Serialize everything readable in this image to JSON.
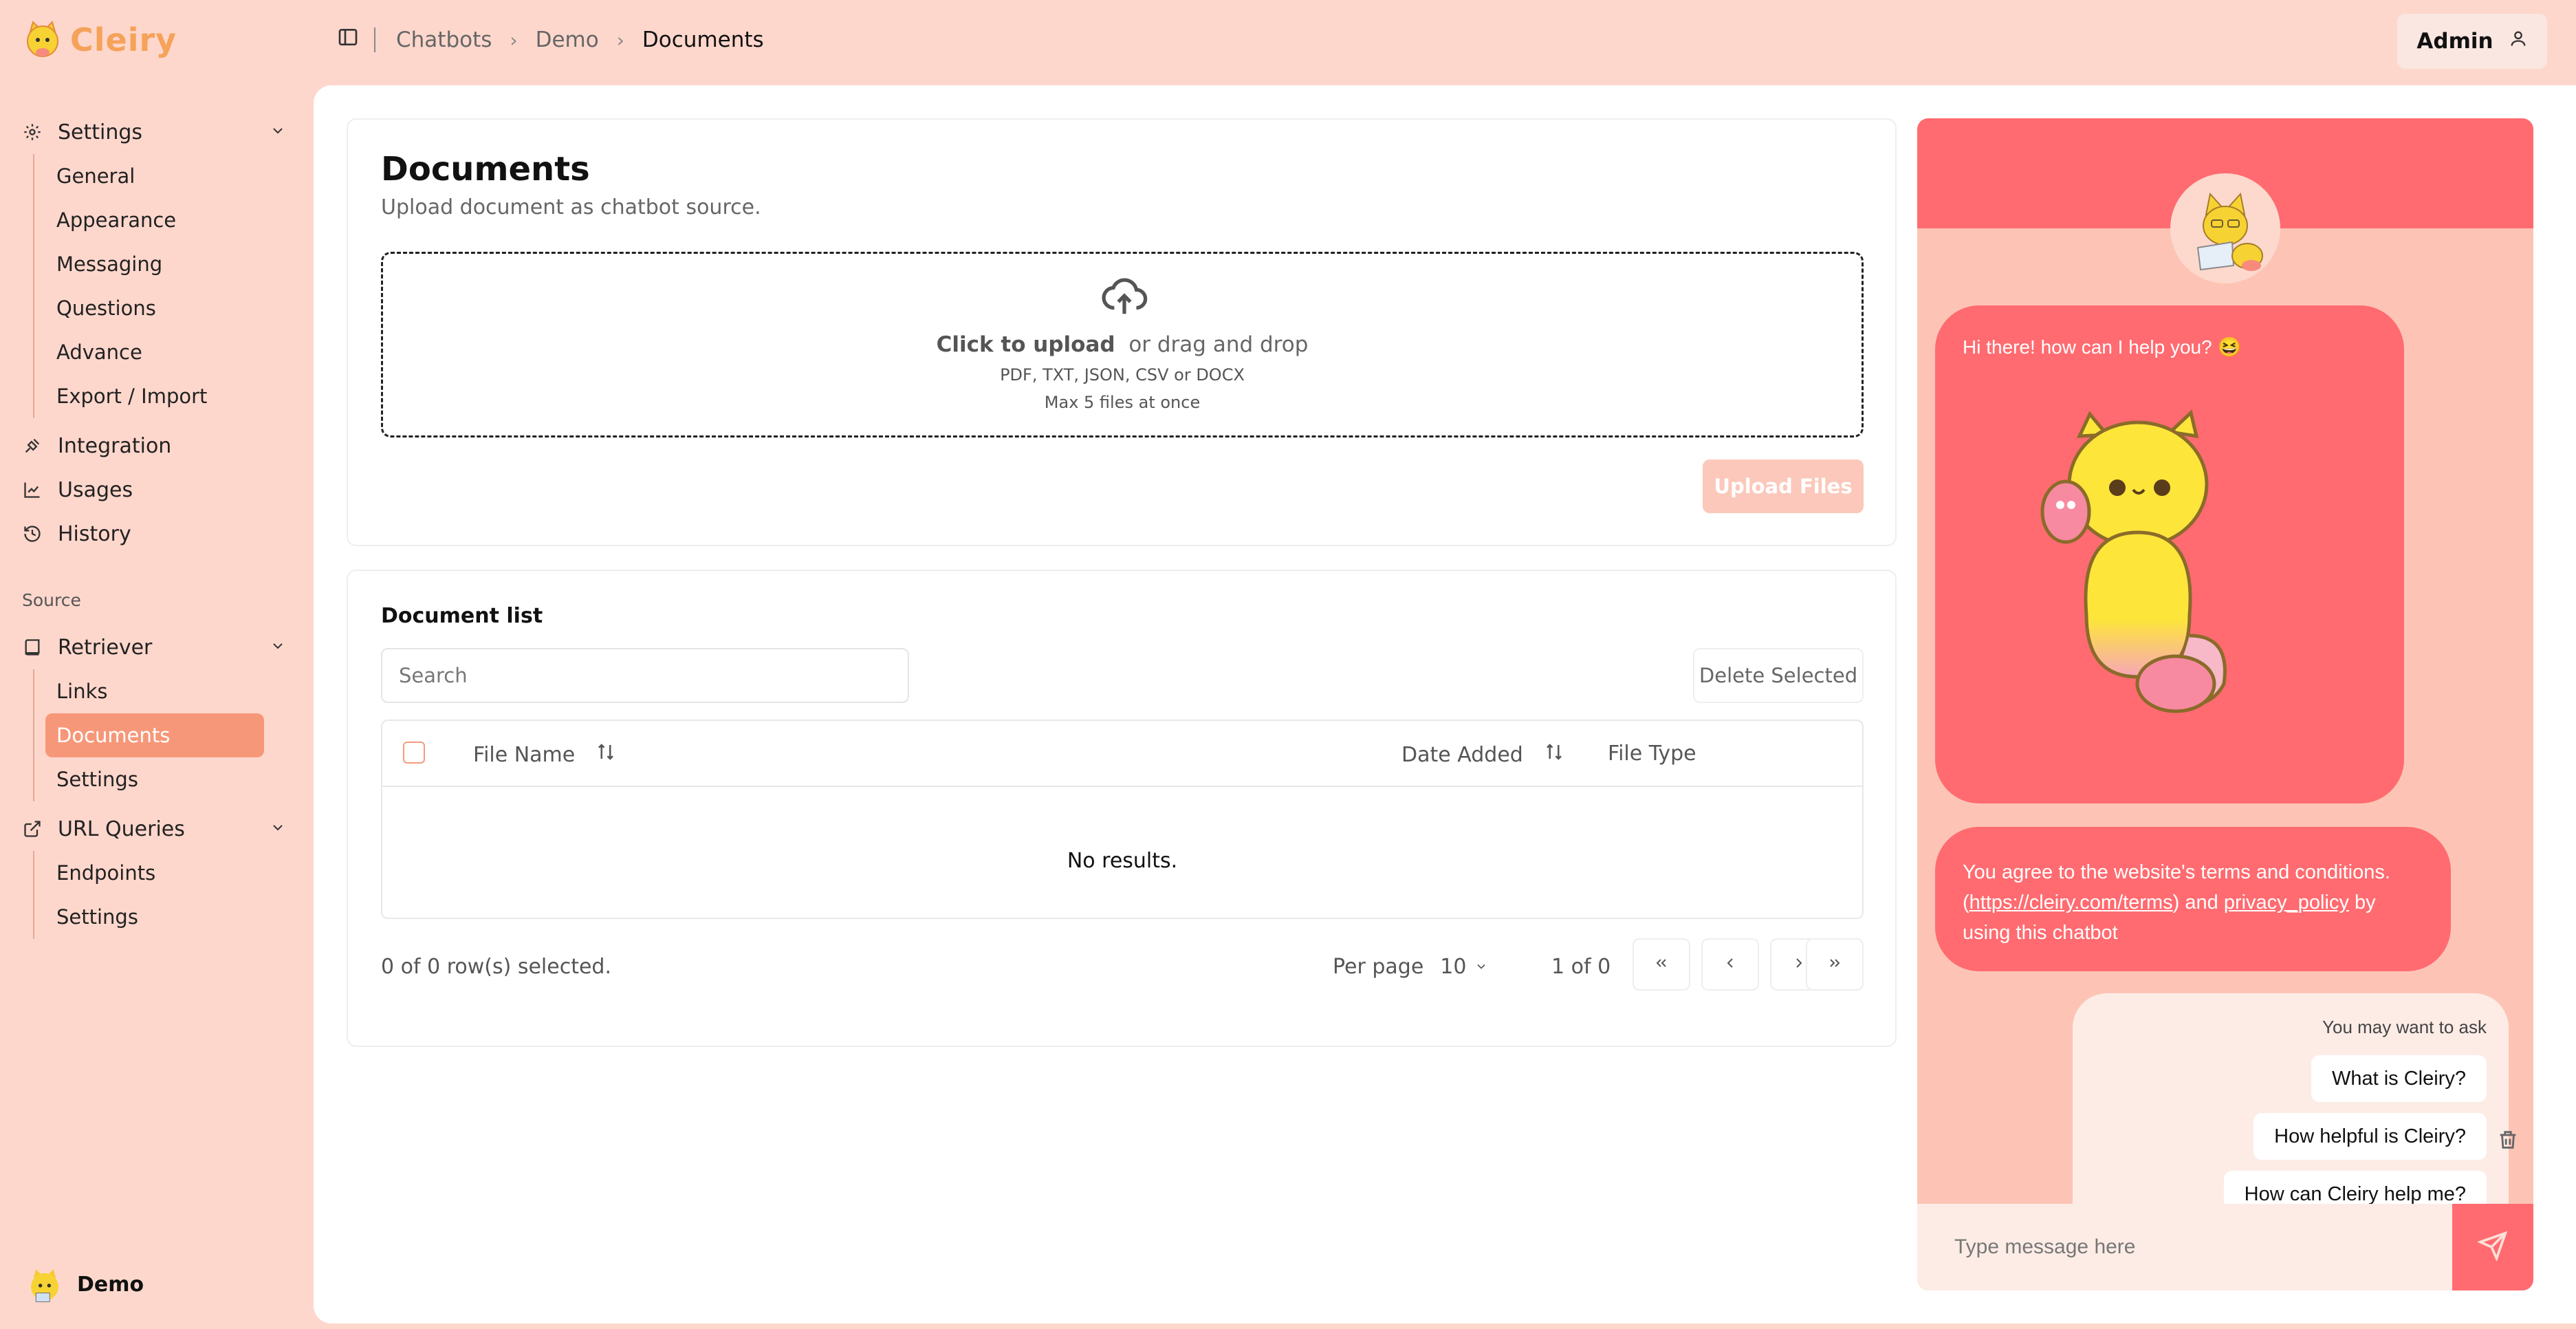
{
  "brand": {
    "name": "Cleiry"
  },
  "breadcrumb": [
    "Chatbots",
    "Demo",
    "Documents"
  ],
  "admin": {
    "label": "Admin"
  },
  "sidebar": {
    "settings": {
      "label": "Settings",
      "items": [
        "General",
        "Appearance",
        "Messaging",
        "Questions",
        "Advance",
        "Export / Import"
      ]
    },
    "integration": "Integration",
    "usages": "Usages",
    "history": "History",
    "source_label": "Source",
    "retriever": {
      "label": "Retriever",
      "items": [
        "Links",
        "Documents",
        "Settings"
      ],
      "active": "Documents"
    },
    "url_queries": {
      "label": "URL Queries",
      "items": [
        "Endpoints",
        "Settings"
      ]
    },
    "profile_name": "Demo"
  },
  "upload": {
    "title": "Documents",
    "subtitle": "Upload document as chatbot source.",
    "click_text": "Click to upload",
    "drag_text": "or drag and drop",
    "formats": "PDF, TXT, JSON, CSV or DOCX",
    "max": "Max 5 files at once",
    "button": "Upload Files"
  },
  "doclist": {
    "title": "Document list",
    "search_placeholder": "Search",
    "delete_button": "Delete Selected",
    "columns": {
      "file_name": "File Name",
      "date_added": "Date Added",
      "file_type": "File Type"
    },
    "empty": "No results.",
    "rows_selected": "0 of 0 row(s) selected.",
    "per_page_label": "Per page",
    "per_page_value": "10",
    "page_of": "1 of 0"
  },
  "chat": {
    "greeting": "Hi there! how can I help you? 😆",
    "terms_prefix": "You agree to the website's terms and conditions.",
    "terms_link": "https://cleiry.com/terms",
    "terms_and": "and",
    "privacy_link": "privacy_policy",
    "terms_suffix": "by using this chatbot",
    "suggest_title": "You may want to ask",
    "suggestions": [
      "What is Cleiry?",
      "How helpful is Cleiry?",
      "How can Cleiry help me?"
    ],
    "input_placeholder": "Type message here"
  },
  "colors": {
    "accent": "#ff6b70",
    "sidebar_bg": "#fed7cc",
    "active_item": "#f79779"
  }
}
